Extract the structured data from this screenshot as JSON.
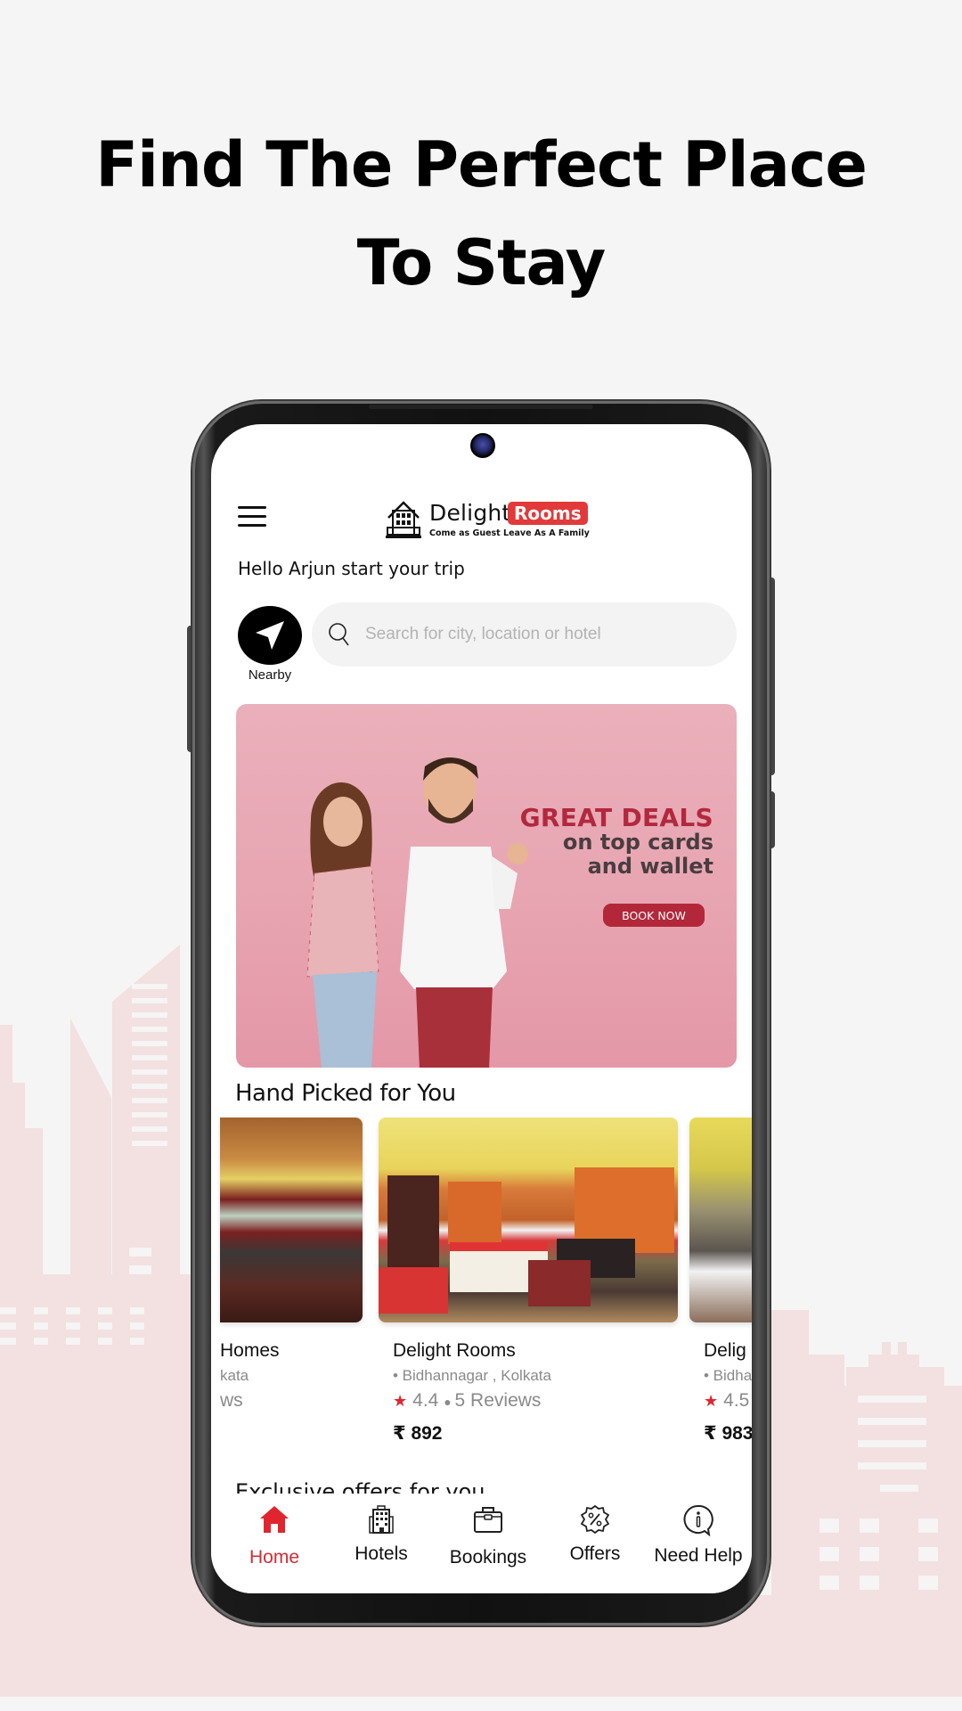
{
  "promo": {
    "headline_line1": "Find The Perfect Place",
    "headline_line2": "To Stay"
  },
  "app": {
    "brand_primary": "Delight",
    "brand_secondary": "Rooms",
    "tagline": "Come as Guest Leave As A Family",
    "accent_color": "#e23a3a",
    "greeting": "Hello Arjun start your trip"
  },
  "search": {
    "nearby_label": "Nearby",
    "placeholder": "Search for city, location or hotel",
    "value": ""
  },
  "banner": {
    "title": "GREAT DEALS",
    "subtitle_line1": "on top cards",
    "subtitle_line2": "and wallet",
    "cta": "BOOK NOW",
    "slide_count": 3,
    "active_slide": 1
  },
  "hand_picked": {
    "title": "Hand Picked for You",
    "cards": [
      {
        "name": "Homes",
        "location": "kata",
        "rating_text": "ws",
        "price": ""
      },
      {
        "name": "Delight Rooms",
        "location": "• Bidhannagar , Kolkata",
        "rating": "4.4",
        "reviews": "5 Reviews",
        "price": "₹ 892"
      },
      {
        "name": "Delig",
        "location": "• Bidha",
        "rating": "4.5",
        "reviews": "",
        "price": "₹ 983"
      }
    ]
  },
  "exclusive": {
    "title": "Exclusive offers for you"
  },
  "bottom_nav": {
    "items": [
      {
        "label": "Home",
        "icon": "home-icon",
        "active": true
      },
      {
        "label": "Hotels",
        "icon": "building-icon",
        "active": false
      },
      {
        "label": "Bookings",
        "icon": "briefcase-icon",
        "active": false
      },
      {
        "label": "Offers",
        "icon": "discount-badge-icon",
        "active": false
      },
      {
        "label": "Need Help",
        "icon": "info-chat-icon",
        "active": false
      }
    ]
  }
}
